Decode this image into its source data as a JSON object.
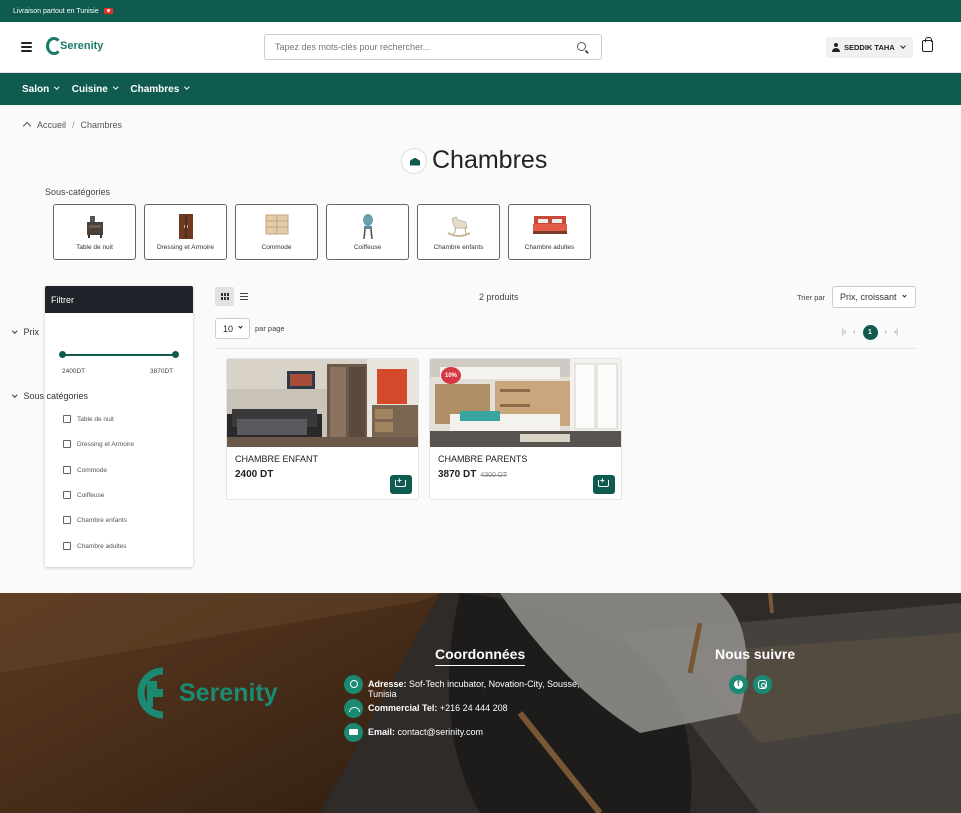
{
  "topbar": {
    "text": "Livraison partout en Tunisie"
  },
  "header": {
    "logo_text": "Serenity",
    "search_placeholder": "Tapez des mots-clés pour rechercher...",
    "user_name": "SEDDIK TAHA"
  },
  "nav": {
    "items": [
      "Salon",
      "Cuisine",
      "Chambres"
    ]
  },
  "breadcrumb": {
    "home": "Accueil",
    "current": "Chambres"
  },
  "page": {
    "title": "Chambres"
  },
  "subcategories": {
    "label": "Sous-catégories",
    "items": [
      {
        "name": "Table de nuit",
        "icon": "nightstand-icon"
      },
      {
        "name": "Dressing et Armoire",
        "icon": "wardrobe-icon"
      },
      {
        "name": "Commode",
        "icon": "dresser-icon"
      },
      {
        "name": "Coiffeuse",
        "icon": "chair-icon"
      },
      {
        "name": "Chambre enfants",
        "icon": "rocking-horse-icon"
      },
      {
        "name": "Chambre adultes",
        "icon": "bed-icon"
      }
    ]
  },
  "filter": {
    "title": "Filtrer",
    "price_section": "Prix",
    "price_min": "2400DT",
    "price_max": "3870DT",
    "subcat_section": "Sous catégories",
    "options": [
      "Table de nuit",
      "Dressing et Armoire",
      "Commode",
      "Coiffeuse",
      "Chambre enfants",
      "Chambre adultes"
    ]
  },
  "toolbar": {
    "product_count": "2 produits",
    "sort_label": "Trier par",
    "sort_value": "Prix, croissant",
    "per_page_value": "10",
    "per_page_label": "par page",
    "current_page": "1",
    "pager_first": "|‹",
    "pager_prev": "‹",
    "pager_next": "›",
    "pager_last": "›|"
  },
  "products": [
    {
      "name": "CHAMBRE ENFANT",
      "price": "2400 DT",
      "old_price": "",
      "badge": ""
    },
    {
      "name": "CHAMBRE PARENTS",
      "price": "3870 DT",
      "old_price": "4300 DT",
      "badge": "10%"
    }
  ],
  "footer": {
    "logo_text": "Serenity",
    "contact_heading": "Coordonnées",
    "address_label": "Adresse:",
    "address_value": "Sof-Tech incubator, Novation-City, Sousse, Tunisia",
    "phone_label": "Commercial Tel:",
    "phone_value": "+216 24 444 208",
    "email_label": "Email:",
    "email_value": "contact@serinity.com",
    "follow_heading": "Nous suivre"
  },
  "colors": {
    "brand": "#0f5b4f",
    "accent": "#1a8a72",
    "sale": "#d33a44"
  }
}
